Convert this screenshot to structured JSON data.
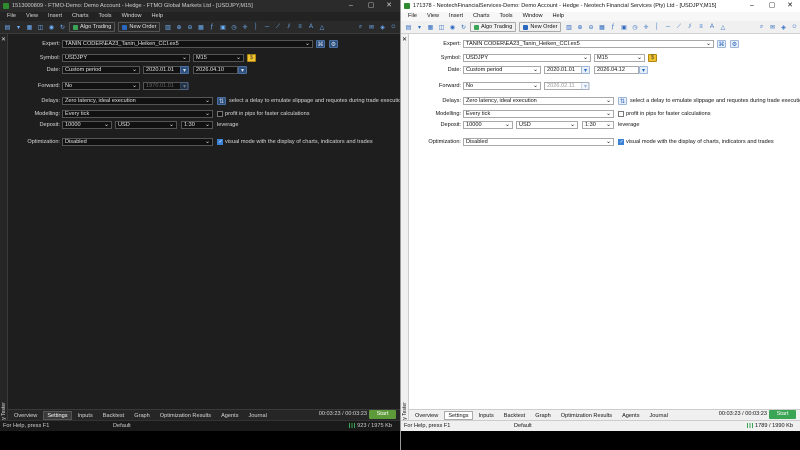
{
  "left": {
    "title": "1513000809 - FTMO-Demo: Demo Account - Hedge - FTMO Global Markets Ltd - [USDJPY,M15]",
    "menu": [
      "File",
      "View",
      "Insert",
      "Charts",
      "Tools",
      "Window",
      "Help"
    ],
    "toolbar": {
      "algo": "Algo Trading",
      "new_order": "New Order"
    },
    "tester": {
      "expert_label": "Expert:",
      "expert": "TANIN CODER\\EA23_Tanin_Heiken_CCI.ex5",
      "symbol_label": "Symbol:",
      "symbol": "USDJPY",
      "timeframe": "M15",
      "date_label": "Date:",
      "period": "Custom period",
      "date_from": "2020.01.01",
      "date_to": "2026.04.10",
      "forward_label": "Forward:",
      "forward": "No",
      "forward_date": "1970.01.01",
      "delays_label": "Delays:",
      "delays": "Zero latency, ideal execution",
      "delays_hint": "select a delay to emulate slippage and requotes during trade execution",
      "modelling_label": "Modelling:",
      "modelling": "Every tick",
      "pips_hint": "profit in pips for faster calculations",
      "deposit_label": "Deposit:",
      "deposit": "10000",
      "currency": "USD",
      "leverage_val": "1:30",
      "leverage": "leverage",
      "optimization_label": "Optimization:",
      "optimization": "Disabled",
      "visual_hint": "visual mode with the display of charts, indicators and trades"
    },
    "strip_label": "Strategy Tester",
    "tabs": [
      "Overview",
      "Settings",
      "Inputs",
      "Backtest",
      "Graph",
      "Optimization Results",
      "Agents",
      "Journal"
    ],
    "timer": "00:03:23 / 00:03:23",
    "start": "Start",
    "status": {
      "help": "For Help, press F1",
      "profile": "Default",
      "net": "923 / 1975 Kb"
    }
  },
  "right": {
    "title": "171378 - NeotechFinancialServices-Demo: Demo Account - Hedge - Neotech Financial Services (Pty) Ltd - [USDJPY,M15]",
    "menu": [
      "File",
      "View",
      "Insert",
      "Charts",
      "Tools",
      "Window",
      "Help"
    ],
    "toolbar": {
      "algo": "Algo Trading",
      "new_order": "New Order"
    },
    "tester": {
      "expert_label": "Expert:",
      "expert": "TANIN CODER\\EA23_Tanin_Heiken_CCI.ex5",
      "symbol_label": "Symbol:",
      "symbol": "USDJPY",
      "timeframe": "M15",
      "date_label": "Date:",
      "period": "Custom period",
      "date_from": "2020.01.01",
      "date_to": "2026.04.12",
      "forward_label": "Forward:",
      "forward": "No",
      "forward_date": "2026.02.11",
      "delays_label": "Delays:",
      "delays": "Zero latency, ideal execution",
      "delays_hint": "select a delay to emulate slippage and requotes during trade execution",
      "modelling_label": "Modelling:",
      "modelling": "Every tick",
      "pips_hint": "profit in pips for faster calculations",
      "deposit_label": "Deposit:",
      "deposit": "10000",
      "currency": "USD",
      "leverage_val": "1:30",
      "leverage": "leverage",
      "optimization_label": "Optimization:",
      "optimization": "Disabled",
      "visual_hint": "visual mode with the display of charts, indicators and trades"
    },
    "strip_label": "Strategy Tester",
    "tabs": [
      "Overview",
      "Settings",
      "Inputs",
      "Backtest",
      "Graph",
      "Optimization Results",
      "Agents",
      "Journal"
    ],
    "timer": "00:03:23 / 00:03:23",
    "start": "Start",
    "status": {
      "help": "For Help, press F1",
      "profile": "Default",
      "net": "1789 / 1990 Kb"
    }
  },
  "icons": [
    "app-icon",
    "minimize-icon",
    "maximize-icon",
    "close-icon",
    "chart-icon",
    "search-icon",
    "zoom-in-icon",
    "zoom-out-icon",
    "crosshair-icon",
    "line-icon",
    "settings-icon",
    "refresh-icon",
    "copy-icon"
  ]
}
